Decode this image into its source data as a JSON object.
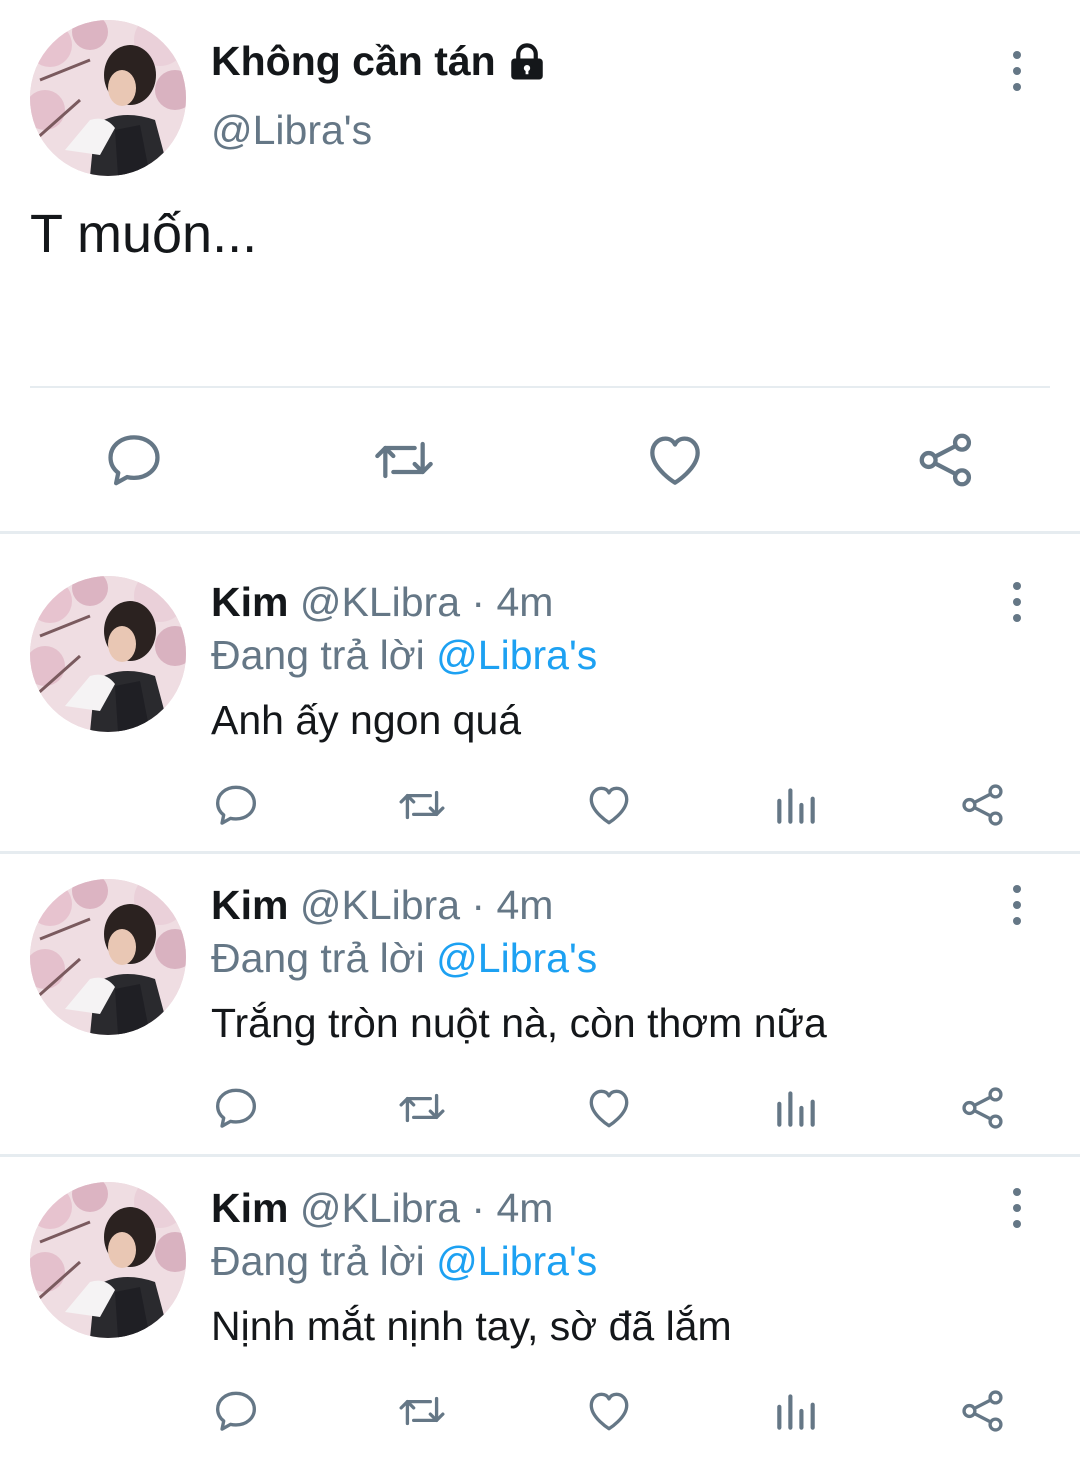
{
  "main_tweet": {
    "display_name": "Không cần tán",
    "handle": "@Libra's",
    "text": "T muốn...",
    "avatar_icon": "avatar-photo",
    "protected_icon": "lock-icon",
    "actions": [
      "reply-icon",
      "retweet-icon",
      "like-icon",
      "share-icon"
    ]
  },
  "replies": [
    {
      "name": "Kim",
      "handle": "@KLibra",
      "separator": "·",
      "time": "4m",
      "replying_label": "Đang trả lời",
      "replying_to": "@Libra's",
      "text": "Anh ấy ngon quá"
    },
    {
      "name": "Kim",
      "handle": "@KLibra",
      "separator": "·",
      "time": "4m",
      "replying_label": "Đang trả lời",
      "replying_to": "@Libra's",
      "text": "Trắng tròn nuột nà, còn thơm nữa"
    },
    {
      "name": "Kim",
      "handle": "@KLibra",
      "separator": "·",
      "time": "4m",
      "replying_label": "Đang trả lời",
      "replying_to": "@Libra's",
      "text": "Nịnh mắt nịnh tay, sờ đã lắm"
    }
  ],
  "colors": {
    "text": "#14171a",
    "secondary": "#657786",
    "accent": "#1da1f2",
    "divider": "#e6ecf0"
  }
}
